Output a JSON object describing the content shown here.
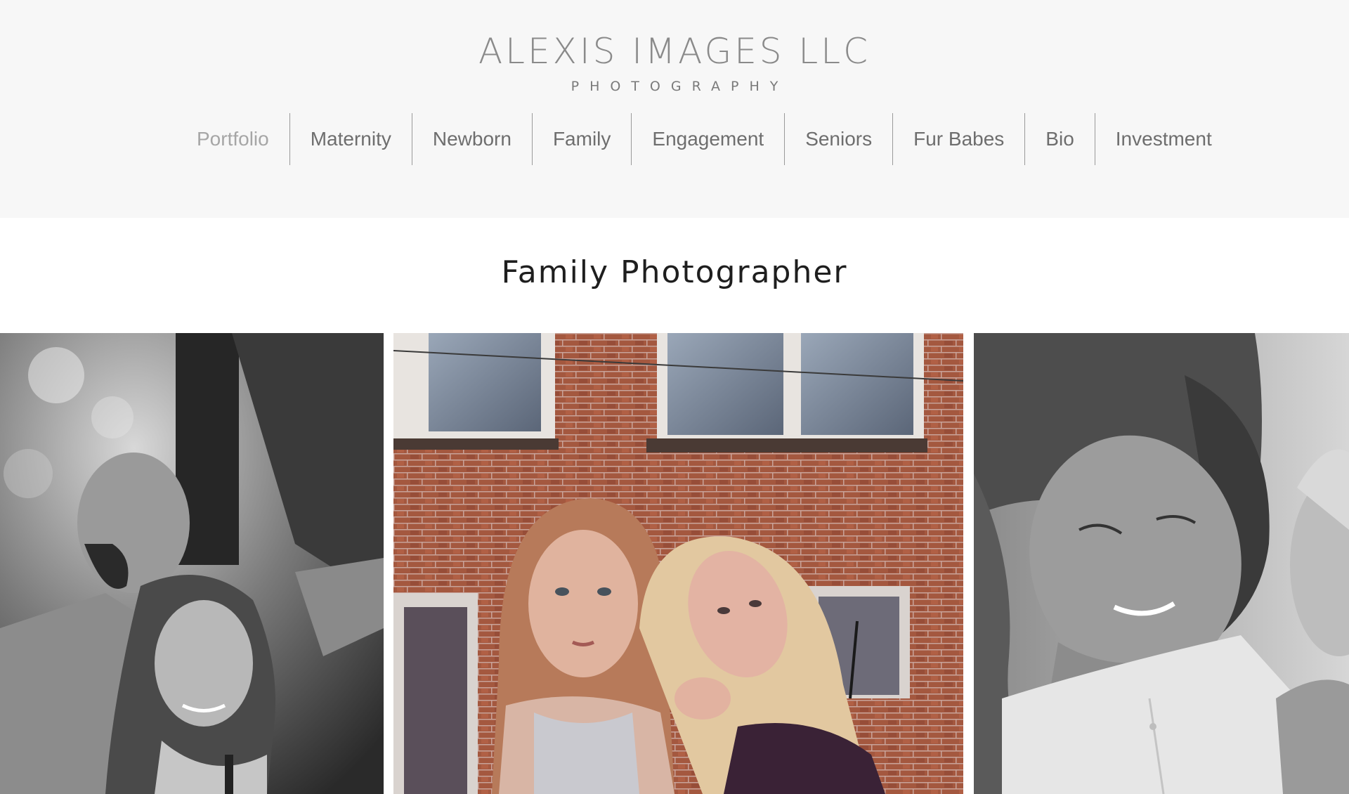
{
  "brand": {
    "title": "ALEXIS IMAGES LLC",
    "subtitle": "PHOTOGRAPHY"
  },
  "nav": {
    "active": "Portfolio",
    "items": [
      {
        "label": "Portfolio"
      },
      {
        "label": "Maternity"
      },
      {
        "label": "Newborn"
      },
      {
        "label": "Family"
      },
      {
        "label": "Engagement"
      },
      {
        "label": "Seniors"
      },
      {
        "label": "Fur Babes"
      },
      {
        "label": "Bio"
      },
      {
        "label": "Investment"
      }
    ]
  },
  "page": {
    "title": "Family Photographer"
  },
  "gallery": {
    "photos": [
      {
        "name": "couple-photo",
        "tone": "black-and-white"
      },
      {
        "name": "sisters-photo",
        "tone": "color"
      },
      {
        "name": "mother-child-photo",
        "tone": "black-and-white"
      }
    ]
  },
  "colors": {
    "header_bg": "#f7f7f7",
    "body_bg": "#ffffff",
    "nav_text": "#6e6e6e",
    "nav_active": "#a6a6a6",
    "brick": "#a4583f"
  }
}
